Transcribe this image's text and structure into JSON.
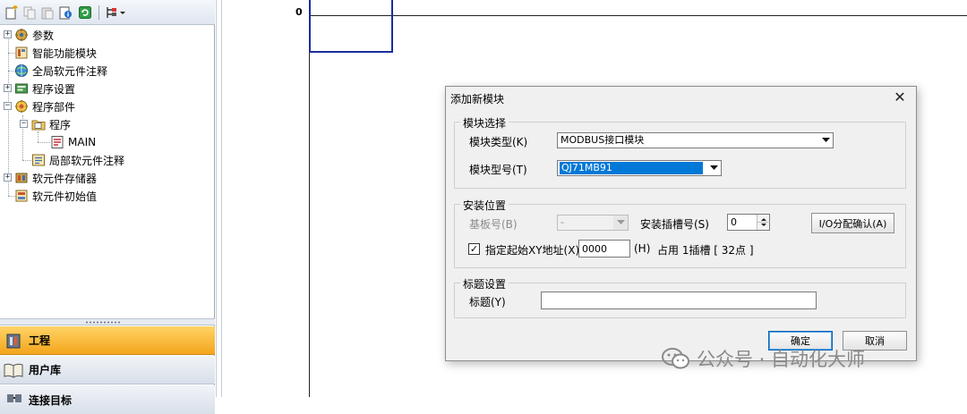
{
  "tree": {
    "items": [
      {
        "label": "参数",
        "icon": "parameter-icon"
      },
      {
        "label": "智能功能模块",
        "icon": "intelligent-module-icon"
      },
      {
        "label": "全局软元件注释",
        "icon": "global-comment-icon"
      },
      {
        "label": "程序设置",
        "icon": "program-setting-icon"
      },
      {
        "label": "程序部件",
        "icon": "program-parts-icon"
      },
      {
        "label": "程序",
        "icon": "folder-icon"
      },
      {
        "label": "MAIN",
        "icon": "program-file-icon"
      },
      {
        "label": "局部软元件注释",
        "icon": "local-comment-icon"
      },
      {
        "label": "软元件存储器",
        "icon": "device-memory-icon"
      },
      {
        "label": "软元件初始值",
        "icon": "device-initial-icon"
      }
    ]
  },
  "nav": {
    "project": "工程",
    "library": "用户库",
    "connection": "连接目标"
  },
  "editor": {
    "step_number": "0"
  },
  "dialog": {
    "title": "添加新模块",
    "close_symbol": "✕",
    "module_group": {
      "legend": "模块选择",
      "type_label": "模块类型(K)",
      "type_value": "MODBUS接口模块",
      "model_label": "模块型号(T)",
      "model_value": "QJ71MB91"
    },
    "mount_group": {
      "legend": "安装位置",
      "base_label": "基板号(B)",
      "base_value": "-",
      "slot_label": "安装插槽号(S)",
      "slot_value": "0",
      "io_confirm_button": "I/O分配确认(A)",
      "xy_checkbox_mark": "✓",
      "xy_label": "指定起始XY地址(X)",
      "xy_value": "0000",
      "hex_label": "(H)",
      "occupy_text": "占用 1插槽 [ 32点 ]"
    },
    "title_group": {
      "legend": "标题设置",
      "title_label": "标题(Y)",
      "title_value": ""
    },
    "ok_button": "确定",
    "cancel_button": "取消"
  },
  "watermark": {
    "text": "公众号 · 自动化大师"
  },
  "colors": {
    "accent_tab": "#f3a51c",
    "selection_blue": "#0078d7",
    "cursor_blue": "#1c2d9c"
  }
}
